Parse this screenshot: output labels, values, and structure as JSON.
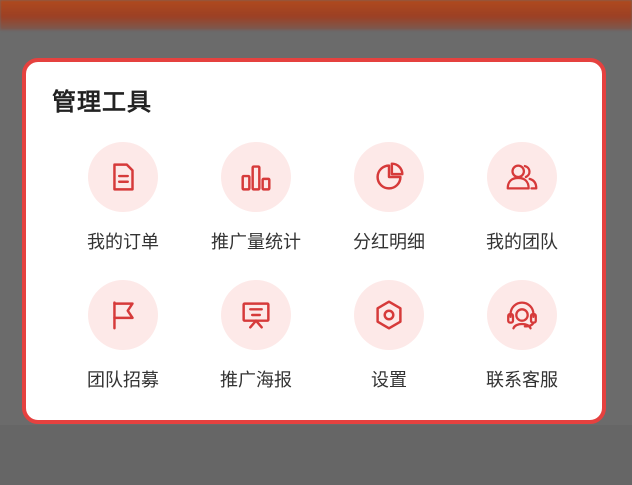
{
  "panel": {
    "title": "管理工具",
    "accent_color": "#e5413f",
    "icon_bg_color": "#fde9e8"
  },
  "tools": [
    {
      "label": "我的订单",
      "icon": "document-icon"
    },
    {
      "label": "推广量统计",
      "icon": "bar-chart-icon"
    },
    {
      "label": "分红明细",
      "icon": "pie-chart-icon"
    },
    {
      "label": "我的团队",
      "icon": "users-icon"
    },
    {
      "label": "团队招募",
      "icon": "flag-icon"
    },
    {
      "label": "推广海报",
      "icon": "presentation-icon"
    },
    {
      "label": "设置",
      "icon": "settings-hexagon-icon"
    },
    {
      "label": "联系客服",
      "icon": "headset-icon"
    }
  ]
}
